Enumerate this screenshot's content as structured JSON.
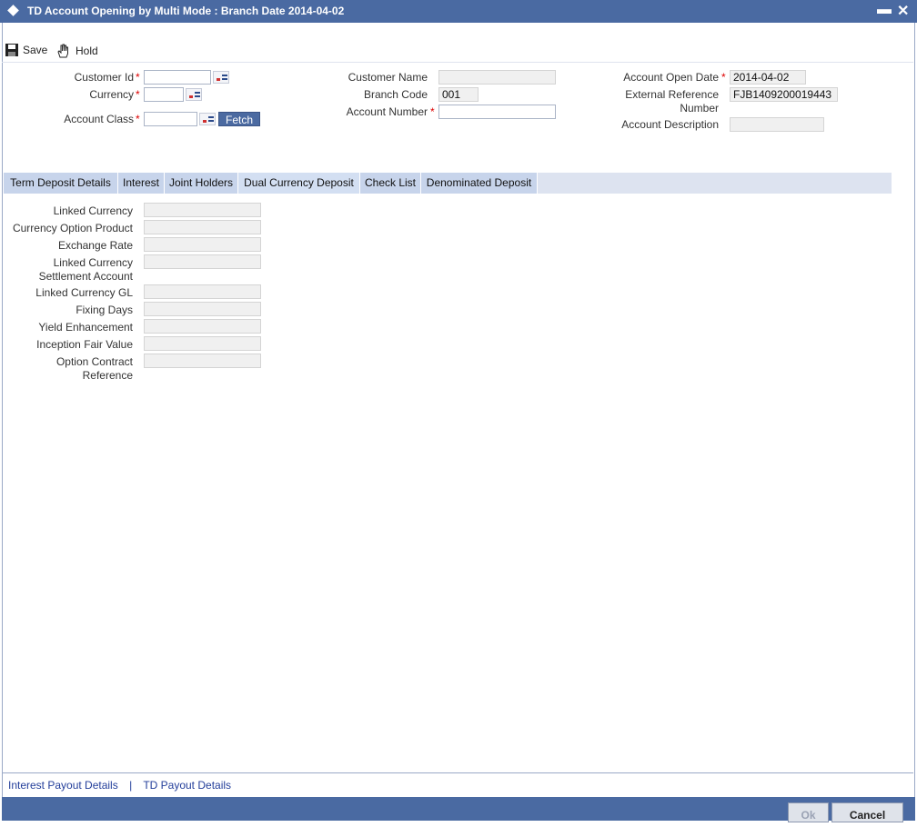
{
  "window": {
    "title": "TD Account Opening by Multi Mode : Branch Date 2014-04-02",
    "minimize": "▬",
    "close": "✕"
  },
  "toolbar": {
    "save_label": "Save",
    "hold_label": "Hold"
  },
  "header": {
    "customer_id": {
      "label": "Customer Id",
      "value": ""
    },
    "currency": {
      "label": "Currency",
      "value": ""
    },
    "account_class": {
      "label": "Account Class",
      "value": ""
    },
    "fetch_label": "Fetch",
    "customer_name": {
      "label": "Customer Name",
      "value": ""
    },
    "branch_code": {
      "label": "Branch Code",
      "value": "001"
    },
    "account_number": {
      "label": "Account Number",
      "value": ""
    },
    "account_open_date": {
      "label": "Account Open Date",
      "value": "2014-04-02"
    },
    "external_reference": {
      "label_line1": "External Reference",
      "label_line2": "Number",
      "value": "FJB1409200019443"
    },
    "account_description": {
      "label": "Account Description",
      "value": ""
    },
    "required_mark": "*"
  },
  "tabs": [
    {
      "label": "Term Deposit Details"
    },
    {
      "label": "Interest"
    },
    {
      "label": "Joint Holders"
    },
    {
      "label": "Dual Currency Deposit"
    },
    {
      "label": "Check List"
    },
    {
      "label": "Denominated Deposit"
    }
  ],
  "dual_currency": {
    "linked_currency": {
      "label": "Linked Currency",
      "value": ""
    },
    "currency_option_product": {
      "label": "Currency Option Product",
      "value": ""
    },
    "exchange_rate": {
      "label": "Exchange Rate",
      "value": ""
    },
    "linked_currency_settlement_account": {
      "label_line1": "Linked Currency",
      "label_line2": "Settlement Account",
      "value": ""
    },
    "linked_currency_gl": {
      "label": "Linked Currency GL",
      "value": ""
    },
    "fixing_days": {
      "label": "Fixing Days",
      "value": ""
    },
    "yield_enhancement": {
      "label": "Yield Enhancement",
      "value": ""
    },
    "inception_fair_value": {
      "label": "Inception Fair Value",
      "value": ""
    },
    "option_contract_reference": {
      "label_line1": "Option Contract",
      "label_line2": "Reference",
      "value": ""
    }
  },
  "bottom_links": {
    "interest_payout": "Interest Payout Details",
    "separator": "|",
    "td_payout": "TD Payout Details"
  },
  "footer": {
    "ok_label": "Ok",
    "cancel_label": "Cancel"
  }
}
